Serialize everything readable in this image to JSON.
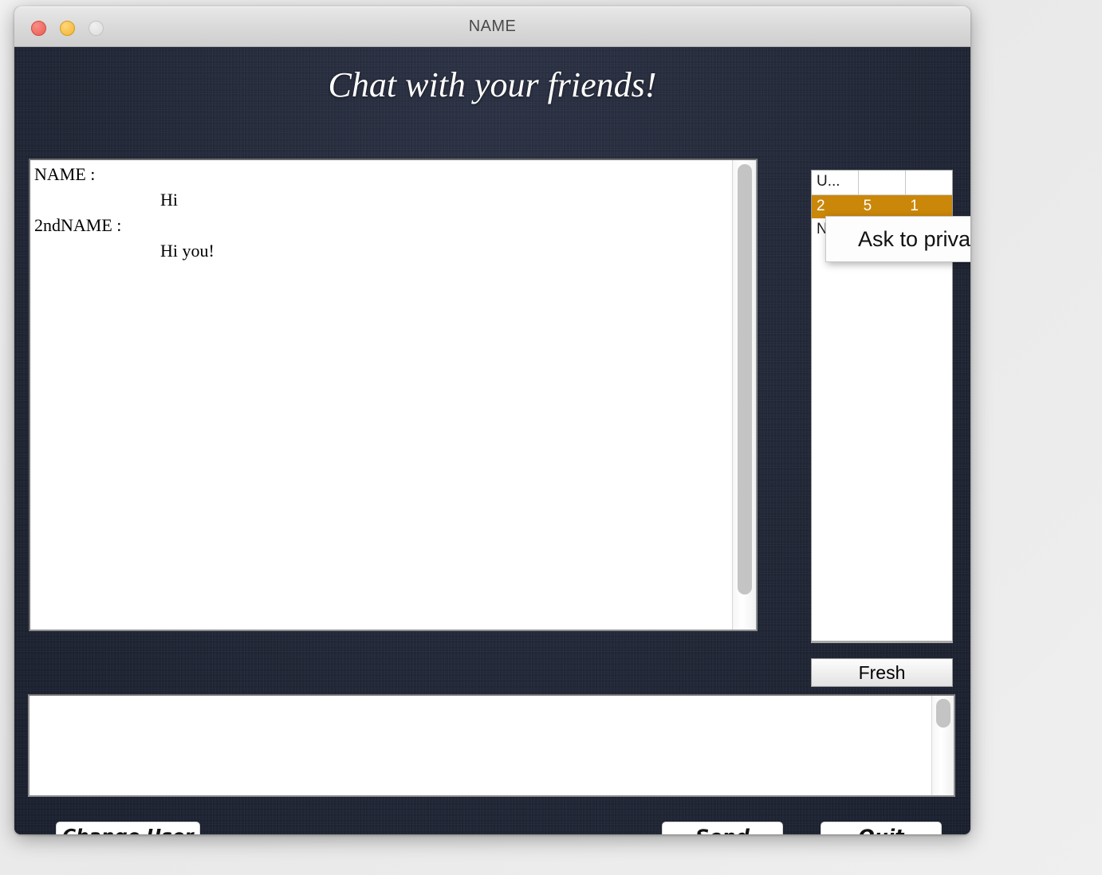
{
  "window": {
    "title": "NAME",
    "controls": {
      "close": "close-button",
      "minimize": "minimize-button",
      "zoom": "zoom-button"
    }
  },
  "banner": {
    "heading": "Chat with your friends!"
  },
  "chat": {
    "messages": [
      {
        "sender": "NAME :",
        "body": "Hi"
      },
      {
        "sender": "2ndNAME :",
        "body": "Hi you!"
      }
    ]
  },
  "users": {
    "header": [
      "U...",
      "",
      ""
    ],
    "rows": [
      {
        "cells": [
          "2",
          "5",
          "1"
        ],
        "selected": true
      },
      {
        "cells": [
          "N...",
          "",
          ""
        ],
        "selected": false
      }
    ],
    "selected_color": "#ca8709",
    "refresh_label": "Fresh"
  },
  "input": {
    "value": "",
    "placeholder": ""
  },
  "buttons": {
    "change_user": "Change User",
    "send": "Send",
    "quit": "Quit"
  },
  "context_menu": {
    "items": [
      "Ask to private chat"
    ]
  },
  "colors": {
    "app_background": "#242a3c",
    "accent_orange": "#ca8709",
    "titlebar": "#d9d9d9",
    "panel_white": "#ffffff"
  }
}
